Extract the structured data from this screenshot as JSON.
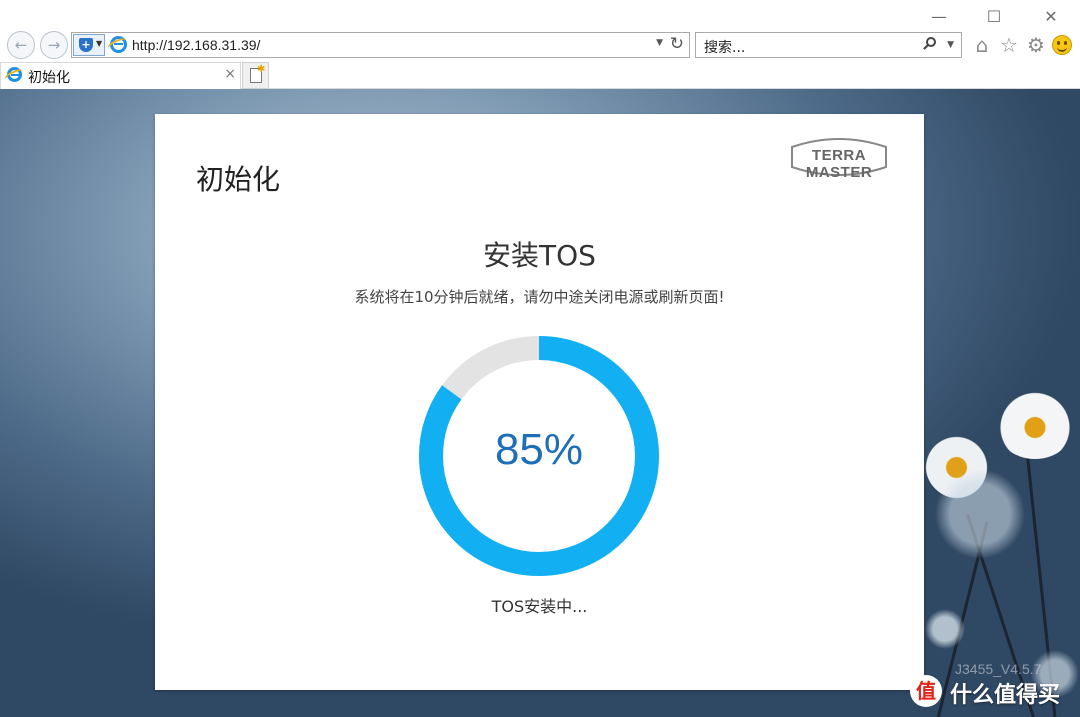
{
  "window": {
    "minimize_icon": "minimize-icon",
    "maximize_icon": "maximize-icon",
    "close_icon": "close-icon"
  },
  "address_bar": {
    "url": "http://192.168.31.39/",
    "back_icon": "back-arrow-icon",
    "forward_icon": "forward-arrow-icon",
    "refresh_icon": "refresh-icon"
  },
  "search_bar": {
    "placeholder": "搜索..."
  },
  "toolbar": {
    "icons": [
      "home-icon",
      "favorites-star-icon",
      "settings-gear-icon",
      "feedback-smiley-icon"
    ]
  },
  "tab": {
    "title": "初始化",
    "close_label": "×"
  },
  "dialog": {
    "title": "初始化",
    "brand_logo": "TERRA MASTER",
    "heading": "安装TOS",
    "subtitle": "系统将在10分钟后就绪，请勿中途关闭电源或刷新页面!",
    "progress": {
      "value": 85,
      "label": "85%",
      "fill_color": "#12b0f3",
      "track_color": "#e3e3e3"
    },
    "status": "TOS安装中..."
  },
  "version": "J3455_V4.5.7",
  "watermark": {
    "badge": "值",
    "text": "什么值得买"
  }
}
